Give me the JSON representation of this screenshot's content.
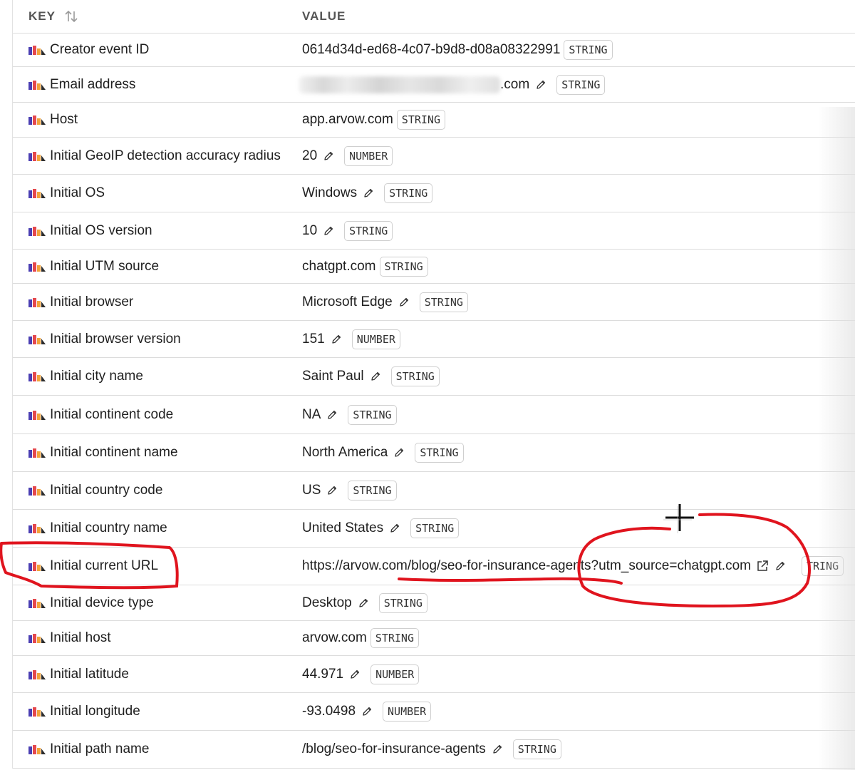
{
  "header": {
    "key": "KEY",
    "value": "VALUE"
  },
  "rows": [
    {
      "key": "Creator event ID",
      "value": "0614d34d-ed68-4c07-b9d8-d08a08322991",
      "type": "STRING",
      "editable": false
    },
    {
      "key": "Email address",
      "value": ".com",
      "type": "STRING",
      "editable": true,
      "redacted": true
    },
    {
      "key": "Host",
      "value": "app.arvow.com",
      "type": "STRING",
      "editable": false
    },
    {
      "key": "Initial GeoIP detection accuracy radius",
      "value": "20",
      "type": "NUMBER",
      "editable": true
    },
    {
      "key": "Initial OS",
      "value": "Windows",
      "type": "STRING",
      "editable": true
    },
    {
      "key": "Initial OS version",
      "value": "10",
      "type": "STRING",
      "editable": true
    },
    {
      "key": "Initial UTM source",
      "value": "chatgpt.com",
      "type": "STRING",
      "editable": false
    },
    {
      "key": "Initial browser",
      "value": "Microsoft Edge",
      "type": "STRING",
      "editable": true
    },
    {
      "key": "Initial browser version",
      "value": "151",
      "type": "NUMBER",
      "editable": true
    },
    {
      "key": "Initial city name",
      "value": "Saint Paul",
      "type": "STRING",
      "editable": true
    },
    {
      "key": "Initial continent code",
      "value": "NA",
      "type": "STRING",
      "editable": true
    },
    {
      "key": "Initial continent name",
      "value": "North America",
      "type": "STRING",
      "editable": true
    },
    {
      "key": "Initial country code",
      "value": "US",
      "type": "STRING",
      "editable": true
    },
    {
      "key": "Initial country name",
      "value": "United States",
      "type": "STRING",
      "editable": true
    },
    {
      "key": "Initial current URL",
      "value": "https://arvow.com/blog/seo-for-insurance-agents?utm_source=chatgpt.com",
      "type": "TRING",
      "editable": true,
      "external_link": true
    },
    {
      "key": "Initial device type",
      "value": "Desktop",
      "type": "STRING",
      "editable": true
    },
    {
      "key": "Initial host",
      "value": "arvow.com",
      "type": "STRING",
      "editable": false
    },
    {
      "key": "Initial latitude",
      "value": "44.971",
      "type": "NUMBER",
      "editable": true
    },
    {
      "key": "Initial longitude",
      "value": "-93.0498",
      "type": "NUMBER",
      "editable": true
    },
    {
      "key": "Initial path name",
      "value": "/blog/seo-for-insurance-agents",
      "type": "STRING",
      "editable": true
    }
  ],
  "icons": {
    "sort": "sort-arrows-icon",
    "key_row": "bar-chart-icon",
    "edit": "pencil-icon",
    "external": "external-link-icon"
  },
  "colors": {
    "annotation": "#e0141e",
    "icon_bar_purple": "#4b3fb3",
    "icon_bar_red": "#e5484d",
    "icon_bar_orange": "#f2a33a"
  }
}
